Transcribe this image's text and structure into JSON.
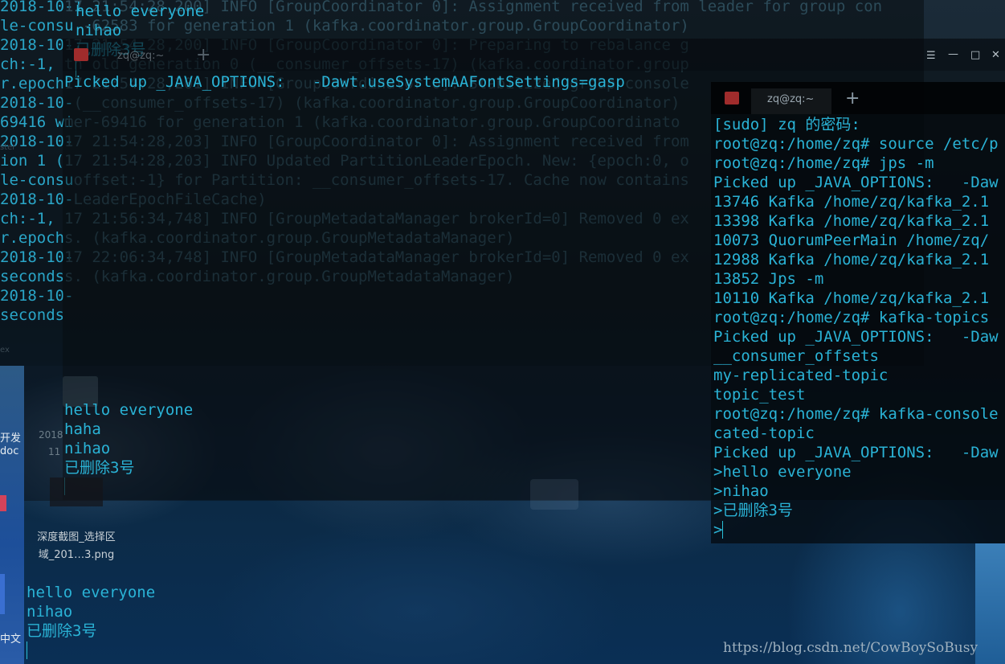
{
  "colors": {
    "text": "#2ab3d6",
    "text_dim": "#1f5b6d",
    "text_faint": "#3a5664",
    "terminal_bg": "#0a0e12",
    "accent_red": "#c0392b"
  },
  "background_terminal": {
    "left_lines": [
      "2018-10-1",
      "le-consu",
      "2018-10-",
      "ch:-1,",
      "r.epoch.",
      "2018-10-",
      "69416 wi",
      "2018-10-",
      "ion 1 (",
      "le-consu",
      "2018-10-",
      "ch:-1,",
      "r.epoch",
      "2018-10-",
      "seconds",
      "2018-10-",
      "seconds"
    ],
    "log_lines": [
      "17 21:54:28,200] INFO [GroupCoordinator 0]: Assignment received from leader for group con",
      "  -62583 for generation 1 (kafka.coordinator.group.GroupCoordinator)",
      "",
      "",
      "",
      "17 21:54:28,200] INFO [GroupCoordinator 0]: Preparing to rebalance g",
      "th old generation 0 (__consumer_offsets-17) (kafka.coordinator.group",
      "17 21:54:28,201] INFO [GroupCoordinator 0]: Stabilized group console",
      " (__consumer_offsets-17) (kafka.coordinator.group.GroupCoordinator)",
      "mer-69416 for generation 1 (kafka.coordinator.group.GroupCoordinato",
      "17 21:54:28,203] INFO [GroupCoordinator 0]: Assignment received from",
      "17 21:54:28,203] INFO Updated PartitionLeaderEpoch. New: {epoch:0, o",
      " offset:-1} for Partition: __consumer_offsets-17. Cache now contains",
      " LeaderEpochFileCache)",
      "17 21:56:34,748] INFO [GroupMetadataManager brokerId=0] Removed 0 ex",
      "s. (kafka.coordinator.group.GroupMetadataManager)",
      "17 22:06:34,748] INFO [GroupMetadataManager brokerId=0] Removed 0 ex",
      "s. (kafka.coordinator.group.GroupMetadataManager)"
    ]
  },
  "top_consumer_overlay": {
    "lines": [
      "hello everyone",
      "nihao",
      "已删除3号"
    ]
  },
  "middle_terminal": {
    "tab_title": "zq@zq:~",
    "picked_up_line": "Picked up _JAVA_OPTIONS:   -Dawt.useSystemAAFontSettings=gasp",
    "window_buttons": [
      "☰",
      "—",
      "□",
      "✕"
    ]
  },
  "consumer_window_1": {
    "lines": [
      "hello everyone",
      "haha",
      "nihao",
      "已删除3号"
    ]
  },
  "consumer_window_2": {
    "lines": [
      "hello everyone",
      "nihao",
      "已删除3号"
    ]
  },
  "right_terminal": {
    "tab_title": "zq@zq:~",
    "lines": [
      "[sudo] zq 的密码:",
      "root@zq:/home/zq# source /etc/p",
      "root@zq:/home/zq# jps -m",
      "Picked up _JAVA_OPTIONS:   -Daw",
      "13746 Kafka /home/zq/kafka_2.1",
      "13398 Kafka /home/zq/kafka_2.1",
      "10073 QuorumPeerMain /home/zq/",
      "12988 Kafka /home/zq/kafka_2.1",
      "13852 Jps -m",
      "10110 Kafka /home/zq/kafka_2.1",
      "root@zq:/home/zq# kafka-topics",
      "Picked up _JAVA_OPTIONS:   -Daw",
      "__consumer_offsets",
      "my-replicated-topic",
      "topic_test",
      "root@zq:/home/zq# kafka-console",
      "cated-topic",
      "Picked up _JAVA_OPTIONS:   -Daw",
      ">hello everyone",
      ">nihao",
      ">已删除3号",
      ">"
    ]
  },
  "desktop": {
    "icons": [
      {
        "label": "深度截图_选择区",
        "sublabel": "域_201…3.png"
      }
    ],
    "side_labels": [
      "开发",
      "doc",
      "中文",
      "2018",
      "11"
    ],
    "faded_labels": [
      "ster",
      "ex"
    ]
  },
  "watermark": "https://blog.csdn.net/CowBoySoBusy"
}
